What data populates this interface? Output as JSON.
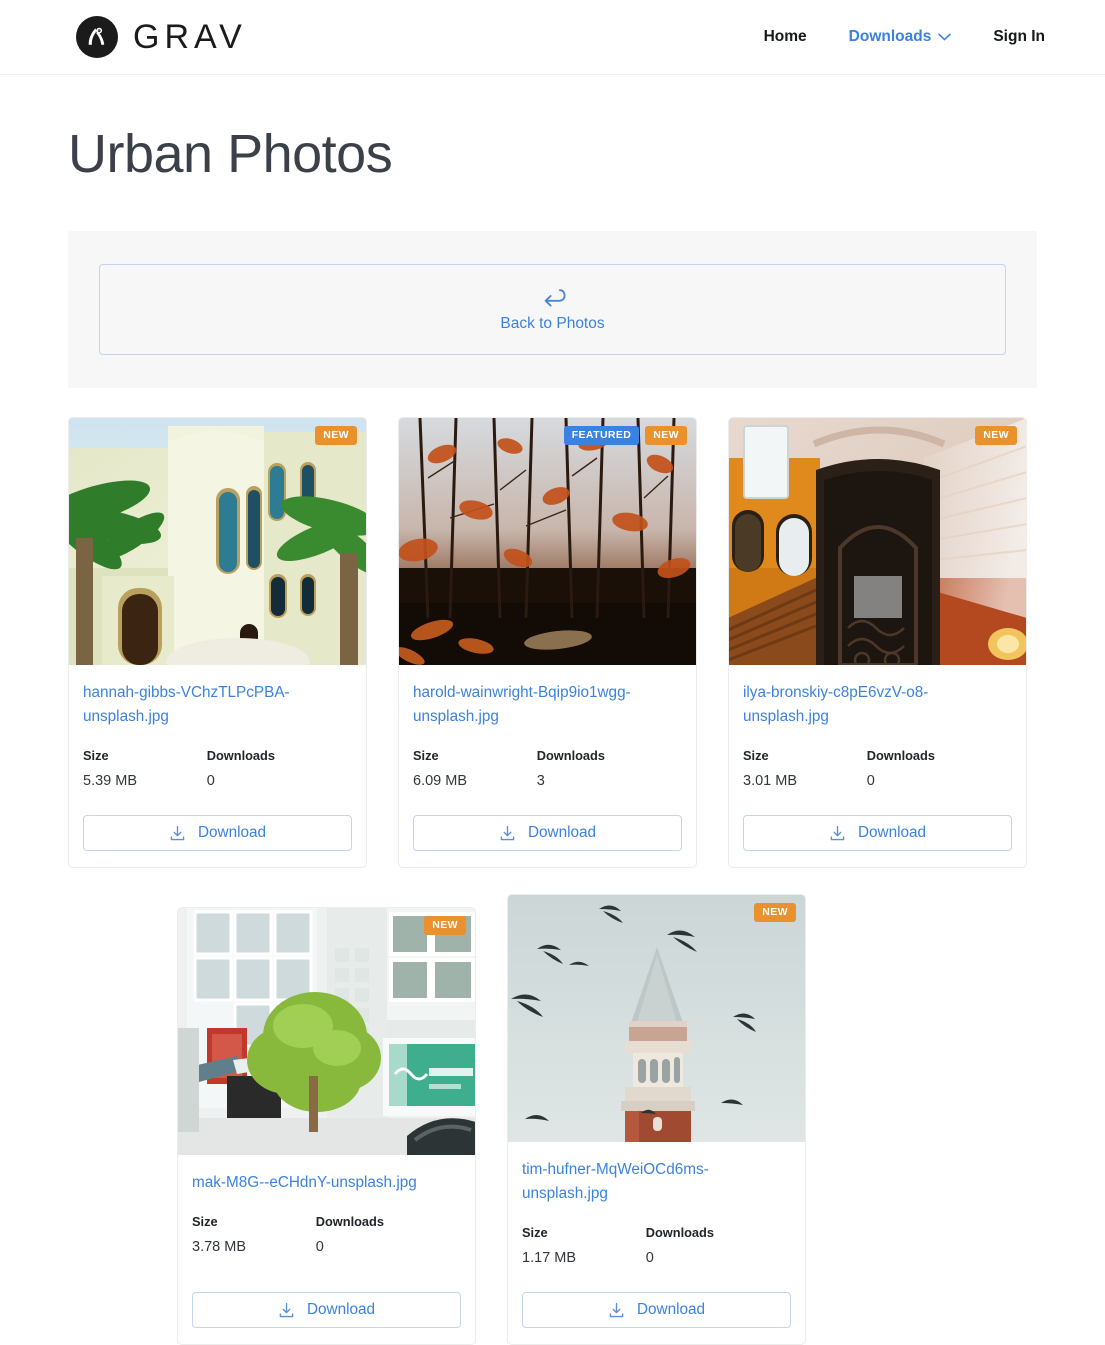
{
  "header": {
    "brand_name": "GRAV",
    "brand_icon": "grav-logo-icon",
    "nav": [
      {
        "label": "Home",
        "active": false,
        "has_chevron": false
      },
      {
        "label": "Downloads",
        "active": true,
        "has_chevron": true
      },
      {
        "label": "Sign In",
        "active": false,
        "has_chevron": false
      }
    ]
  },
  "page": {
    "title": "Urban Photos"
  },
  "back_panel": {
    "icon": "return-arrow-icon",
    "label": "Back to Photos"
  },
  "labels": {
    "size": "Size",
    "downloads": "Downloads",
    "download_button": "Download",
    "badge_new": "NEW",
    "badge_featured": "FEATURED",
    "download_icon": "download-icon"
  },
  "colors": {
    "link_blue": "#3b82e0",
    "badge_new_orange": "#e8912d",
    "badge_featured_blue": "#3b82e0",
    "title_slate": "#3c4149",
    "panel_gray": "#f7f7f7",
    "card_border": "#ececec"
  },
  "cards": [
    {
      "filename": "hannah-gibbs-VChzTLPcPBA-unsplash.jpg",
      "size": "5.39 MB",
      "downloads": "0",
      "badges": [
        "NEW"
      ],
      "thumb_alt": "cream stucco building with palm trees and arched teal windows"
    },
    {
      "filename": "harold-wainwright-Bqip9io1wgg-unsplash.jpg",
      "size": "6.09 MB",
      "downloads": "3",
      "badges": [
        "FEATURED",
        "NEW"
      ],
      "thumb_alt": "autumn forest of bare trees with orange foliage"
    },
    {
      "filename": "ilya-bronskiy-c8pE6vzV-o8-unsplash.jpg",
      "size": "3.01 MB",
      "downloads": "0",
      "badges": [
        "NEW"
      ],
      "thumb_alt": "ornate interior with orange walls and vintage iron elevator"
    },
    {
      "filename": "mak-M8G--eCHdnY-unsplash.jpg",
      "size": "3.78 MB",
      "downloads": "0",
      "badges": [
        "NEW"
      ],
      "thumb_alt": "japanese street with modern buildings and a green tree"
    },
    {
      "filename": "tim-hufner-MqWeiOCd6ms-unsplash.jpg",
      "size": "1.17 MB",
      "downloads": "0",
      "badges": [
        "NEW"
      ],
      "thumb_alt": "venice campanile tower in fog with flying birds"
    }
  ]
}
